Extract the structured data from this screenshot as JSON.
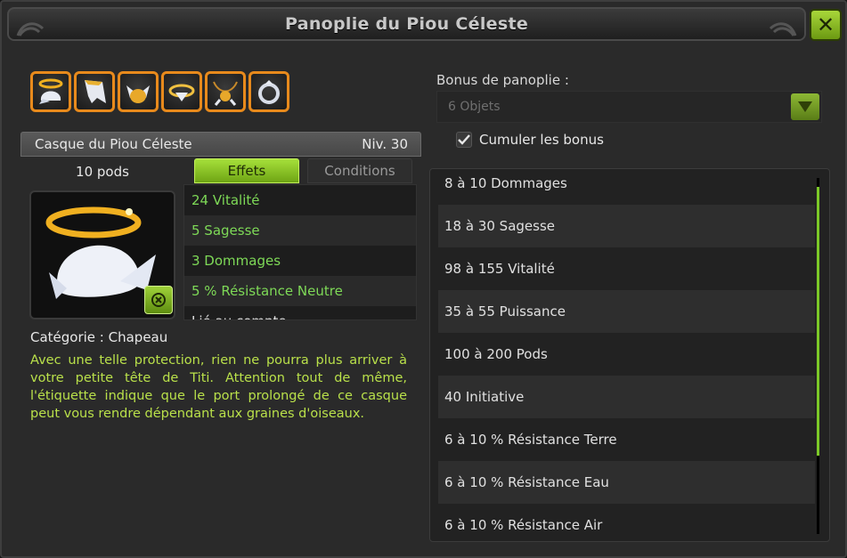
{
  "window": {
    "title": "Panoplie du Piou Céleste",
    "close_label": "✕"
  },
  "set_items": [
    {
      "icon": "halo-helmet-icon"
    },
    {
      "icon": "wing-cape-icon"
    },
    {
      "icon": "shield-wings-icon"
    },
    {
      "icon": "halo-belt-icon"
    },
    {
      "icon": "amulet-icon"
    },
    {
      "icon": "ring-icon"
    }
  ],
  "item": {
    "name": "Casque du Piou Céleste",
    "level": "Niv. 30",
    "pods": "10 pods",
    "category": "Catégorie : Chapeau",
    "description": "Avec une telle protection, rien ne pourra plus arriver à votre petite tête de Titi. Attention tout de même, l'étiquette indique que le port prolongé de ce casque peut vous rendre dépendant aux graines d'oiseaux.",
    "image_icon": "halo-helmet-icon",
    "bonus_badge_icon": "set-bonus-icon"
  },
  "tabs": {
    "effects": "Effets",
    "conditions": "Conditions"
  },
  "effects": [
    "24 Vitalité",
    "5 Sagesse",
    "3 Dommages",
    "5 % Résistance Neutre",
    "Lié au compte"
  ],
  "set_bonus": {
    "label": "Bonus de panoplie :",
    "selected": "6 Objets",
    "cumulate_label": "Cumuler les bonus",
    "cumulate_checked": true,
    "items": [
      "8 à 10 Dommages",
      "18 à 30 Sagesse",
      "98 à 155 Vitalité",
      "35 à 55 Puissance",
      "100 à 200 Pods",
      "40 Initiative",
      "6 à 10 % Résistance Terre",
      "6 à 10 % Résistance Eau",
      "6 à 10 % Résistance Air"
    ]
  },
  "colors": {
    "accent_green": "#7ed957",
    "set_orange": "#e88a1c",
    "description_green": "#b9e04a"
  }
}
